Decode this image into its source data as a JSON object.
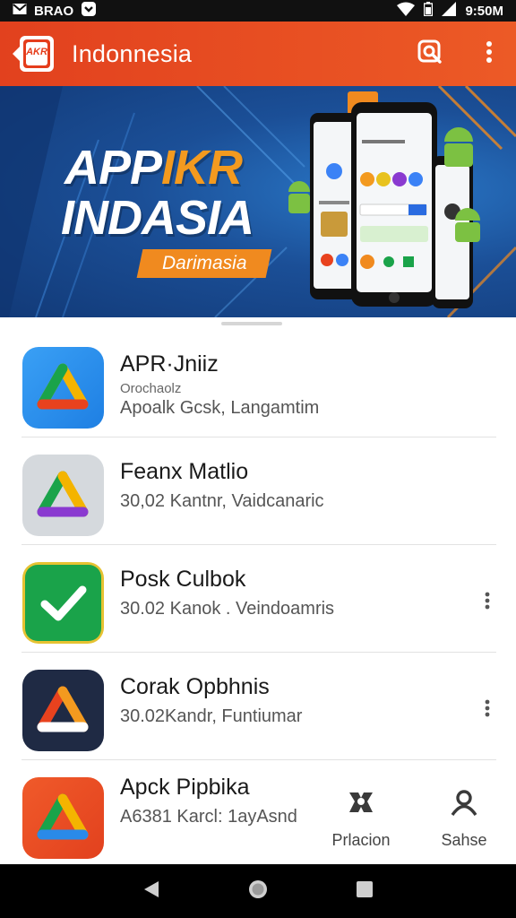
{
  "status_bar": {
    "left_text": "BRAO",
    "time": "9:50M"
  },
  "app_bar": {
    "logo_text": "AKR",
    "title": "Indonnesia",
    "icons": [
      "search-icon",
      "more-vert-icon"
    ]
  },
  "banner": {
    "title_line1_a": "APP",
    "title_line1_b": "IKR",
    "title_line2": "INDASIA",
    "badge": "Darimasia",
    "accent_color": "#f39a1f",
    "background_color": "#1b4f97"
  },
  "apps": [
    {
      "name": "APR·Jniiz",
      "sub": "Orochaolz",
      "meta": "Apoalk Gcsk, Langamtim",
      "icon_color": "#2a8ae8",
      "has_more": false
    },
    {
      "name": "Feanx Matlio",
      "sub": "",
      "meta": "30,02 Kantnr, Vaidcanaric",
      "icon_color": "#d5d9dd",
      "has_more": false
    },
    {
      "name": "Posk Culbok",
      "sub": "",
      "meta": "30.02 Kanok . Veindoamris",
      "icon_color": "#1aa34a",
      "has_more": true
    },
    {
      "name": "Corak Opbhnis",
      "sub": "",
      "meta": "30.02Kandr, Funtiumar",
      "icon_color": "#1f2a44",
      "has_more": true
    },
    {
      "name": "Apck Pipbika",
      "sub": "",
      "meta": "A6381 Karcl: 1ayAsnd",
      "icon_color": "#e8421e",
      "has_more": false
    }
  ],
  "bottom_actions": [
    {
      "label": "Prlacion",
      "icon": "puzzle-icon"
    },
    {
      "label": "Sahse",
      "icon": "person-icon"
    }
  ],
  "nav_bar": {
    "icons": [
      "back-icon",
      "home-icon",
      "recents-icon"
    ]
  }
}
